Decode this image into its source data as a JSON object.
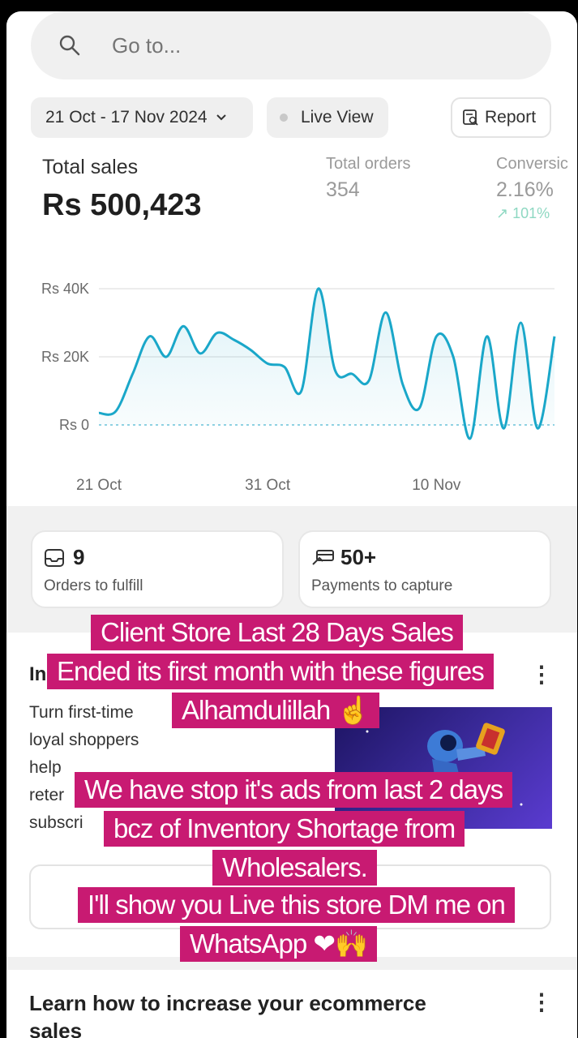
{
  "search": {
    "placeholder": "Go to..."
  },
  "filters": {
    "date_range": "21 Oct - 17 Nov 2024",
    "live_view": "Live View",
    "report": "Report"
  },
  "metrics": {
    "total_sales_label": "Total sales",
    "total_sales_value": "Rs 500,423",
    "total_orders_label": "Total orders",
    "total_orders_value": "354",
    "conversion_label": "Conversic",
    "conversion_value": "2.16%",
    "conversion_trend": "↗ 101%"
  },
  "chart_data": {
    "type": "line",
    "x_tick_labels": [
      "21 Oct",
      "31 Oct",
      "10 Nov"
    ],
    "y_tick_labels": [
      "Rs 40K",
      "Rs 20K",
      "Rs 0"
    ],
    "ylim": [
      0,
      40000
    ],
    "series": [
      {
        "values": [
          3500,
          4000,
          15000,
          26000,
          20000,
          29000,
          21000,
          27000,
          25000,
          22000,
          18000,
          17000,
          10000,
          40000,
          16000,
          15000,
          13000,
          33000,
          12000,
          5000,
          26000,
          20000,
          -4000,
          26000,
          -1000,
          30000,
          -1000,
          26000
        ]
      }
    ],
    "color": "#1aa7c9",
    "grid": true
  },
  "cards": [
    {
      "value": "9",
      "label": "Orders to fulfill",
      "icon": "inbox-icon"
    },
    {
      "value": "50+",
      "label": "Payments to capture",
      "icon": "payment-icon"
    }
  ],
  "promo": {
    "title": "In",
    "text_lines": [
      "Turn first-time",
      "loyal shoppers",
      "help",
      "reter",
      "subscri"
    ]
  },
  "learn": {
    "title": "Learn how to increase your ecommerce sales"
  },
  "captions": {
    "line1": "Client Store Last 28 Days Sales",
    "line2": "Ended its first month with these figures",
    "line3": "Alhamdulillah ☝",
    "line4": "We have stop it's ads from last 2 days",
    "line5": "bcz of Inventory Shortage from",
    "line6": "Wholesalers.",
    "line7": "I'll show you Live this store DM me on",
    "line8": "WhatsApp ❤🙌"
  },
  "colors": {
    "accent": "#1aa7c9",
    "caption_bg": "#c81a72"
  }
}
